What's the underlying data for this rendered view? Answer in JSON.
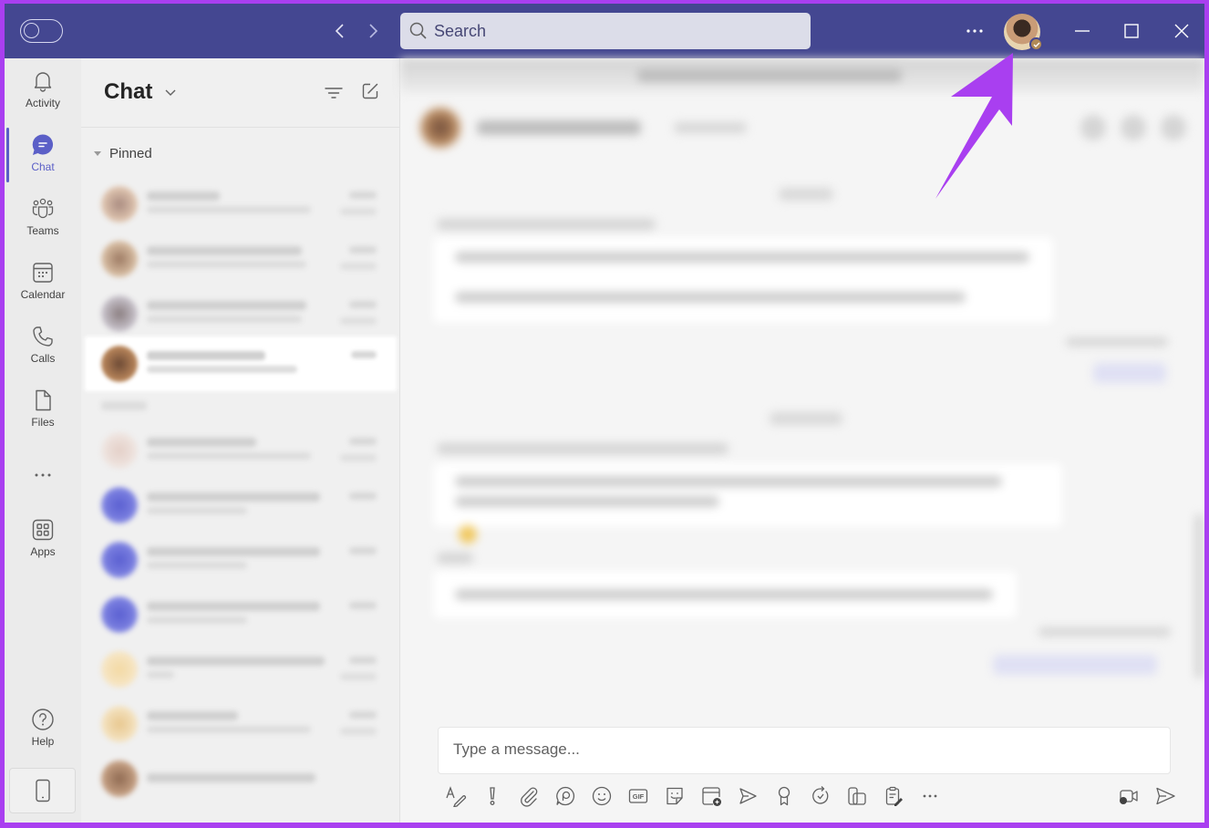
{
  "titlebar": {
    "toggle_icon": "toggle-switch-icon",
    "back_icon": "chevron-left-icon",
    "forward_icon": "chevron-right-icon",
    "search": {
      "placeholder": "Search",
      "value": "",
      "icon": "search-icon"
    },
    "more_icon": "more-horizontal-icon",
    "profile": {
      "icon": "profile-avatar",
      "status": "available"
    },
    "window_controls": [
      "minimize-icon",
      "maximize-icon",
      "close-icon"
    ]
  },
  "rail": {
    "items": [
      {
        "label": "Activity",
        "icon": "bell-icon",
        "active": false
      },
      {
        "label": "Chat",
        "icon": "chat-bubble-icon",
        "active": true
      },
      {
        "label": "Teams",
        "icon": "teams-icon",
        "active": false
      },
      {
        "label": "Calendar",
        "icon": "calendar-icon",
        "active": false
      },
      {
        "label": "Calls",
        "icon": "phone-icon",
        "active": false
      },
      {
        "label": "Files",
        "icon": "file-icon",
        "active": false
      }
    ],
    "more_icon": "more-horizontal-icon",
    "apps": {
      "label": "Apps",
      "icon": "apps-grid-icon"
    },
    "help": {
      "label": "Help",
      "icon": "question-circle-icon"
    },
    "device_icon": "mobile-device-icon"
  },
  "chatlist": {
    "title": "Chat",
    "filter_icon": "filter-icon",
    "compose_icon": "new-chat-icon",
    "pinned_label": "Pinned"
  },
  "conversation": {
    "composer": {
      "placeholder": "Type a message...",
      "value": ""
    },
    "toolbar": [
      "format-icon",
      "priority-icon",
      "attach-icon",
      "loop-icon",
      "emoji-icon",
      "gif-icon",
      "sticker-icon",
      "schedule-meeting-icon",
      "stream-icon",
      "praise-icon",
      "updates-icon",
      "loop-component-icon",
      "forms-icon",
      "more-horizontal-icon"
    ],
    "toolbar_right": [
      "meet-now-icon",
      "send-icon"
    ]
  },
  "colors": {
    "titlebar": "#444791",
    "accent": "#5b5fc7",
    "annotation_arrow": "#a93ff0",
    "frame": "#a93ff0"
  }
}
